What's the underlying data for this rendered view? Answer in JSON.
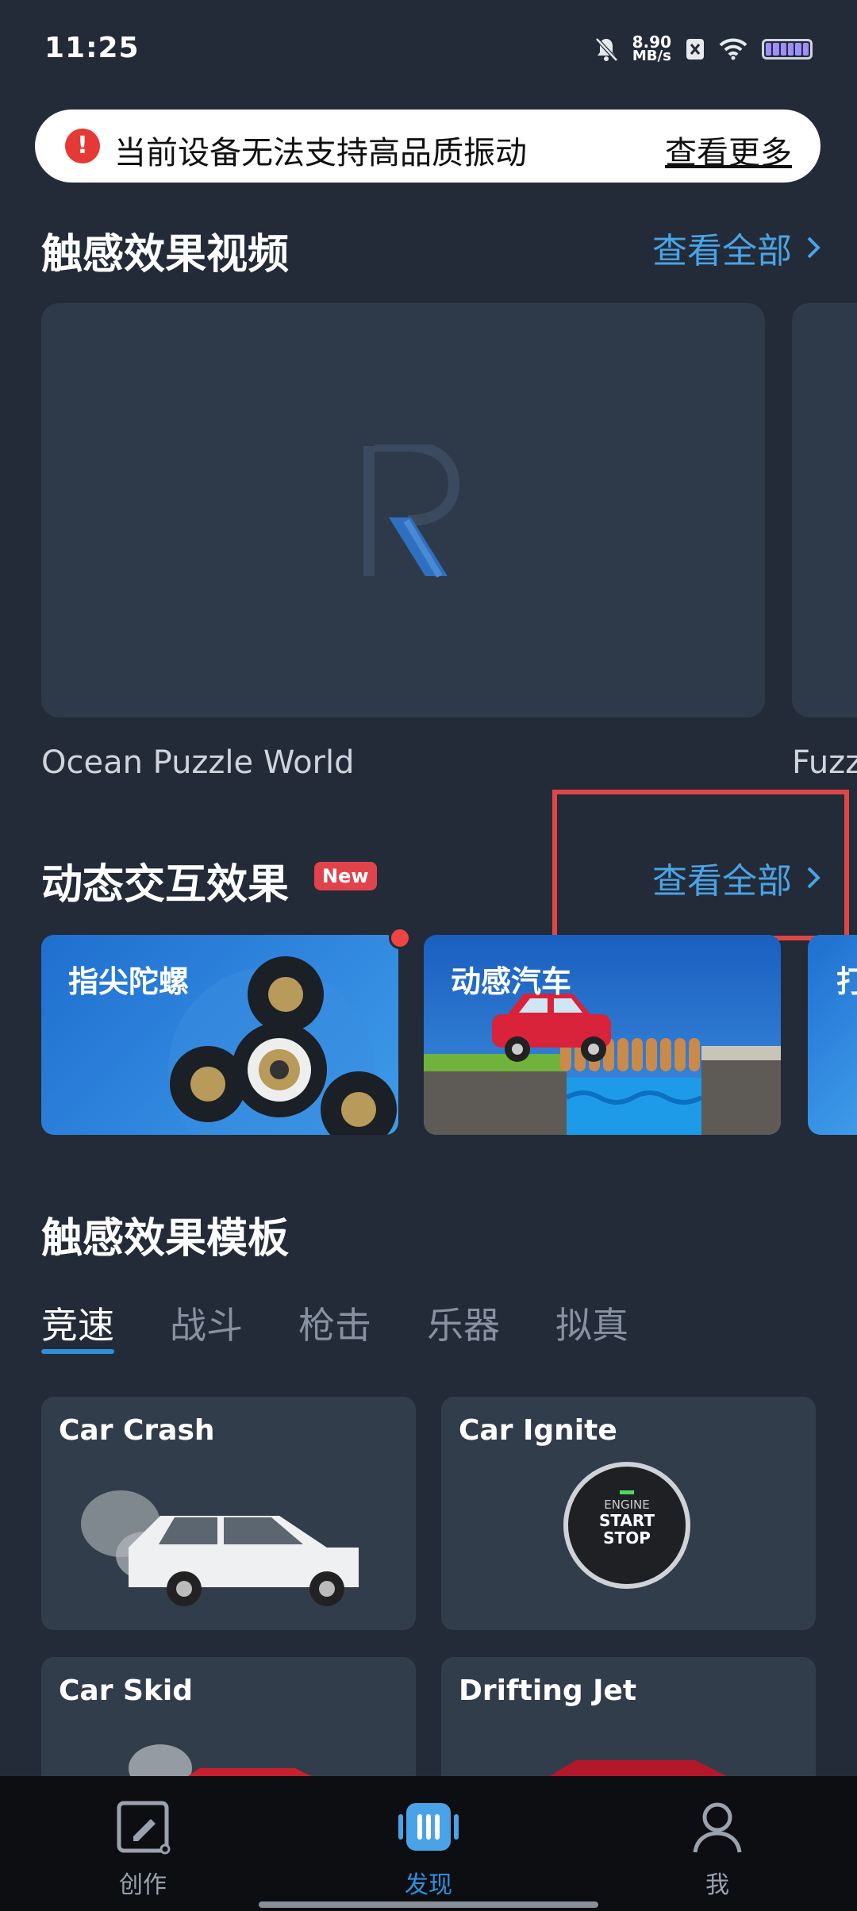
{
  "status_bar": {
    "time": "11:25",
    "net_speed_value": "8.90",
    "net_speed_unit": "MB/s"
  },
  "banner": {
    "message": "当前设备无法支持高品质振动",
    "link": "查看更多"
  },
  "videos_section": {
    "title": "触感效果视频",
    "see_all": "查看全部",
    "items": [
      {
        "caption": "Ocean Puzzle World"
      },
      {
        "caption": "Fuzz"
      }
    ]
  },
  "dynamic_section": {
    "title": "动态交互效果",
    "badge": "New",
    "see_all": "查看全部",
    "items": [
      {
        "label": "指尖陀螺"
      },
      {
        "label": "动感汽车"
      },
      {
        "label": "打"
      }
    ]
  },
  "templates_section": {
    "title": "触感效果模板",
    "tabs": [
      "竞速",
      "战斗",
      "枪击",
      "乐器",
      "拟真"
    ],
    "active_tab": "竞速",
    "items": [
      {
        "title": "Car Crash"
      },
      {
        "title": "Car Ignite",
        "button_text": {
          "line1": "ENGINE",
          "line2": "START",
          "line3": "STOP"
        }
      },
      {
        "title": "Car Skid"
      },
      {
        "title": "Drifting Jet"
      }
    ]
  },
  "bottom_nav": {
    "items": [
      {
        "label": "创作"
      },
      {
        "label": "发现"
      },
      {
        "label": "我"
      }
    ],
    "active": "发现"
  },
  "colors": {
    "background": "#222b37",
    "accent": "#4aa3e6",
    "highlight": "#e04646",
    "badge": "#e0434c"
  }
}
